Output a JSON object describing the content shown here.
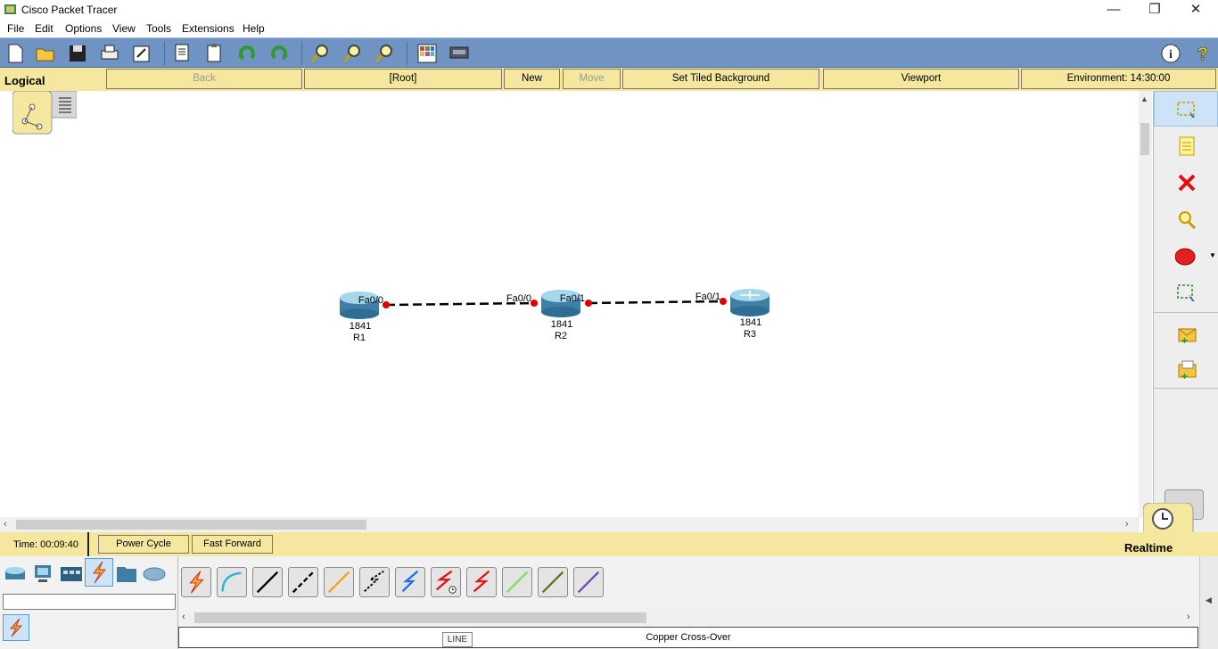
{
  "window": {
    "title": "Cisco Packet Tracer",
    "minimize": "—",
    "maximize": "❐",
    "close": "✕"
  },
  "menu": [
    "File",
    "Edit",
    "Options",
    "View",
    "Tools",
    "Extensions",
    "Help"
  ],
  "toolbar": [
    "new-icon",
    "open-icon",
    "save-icon",
    "print-icon",
    "activity-wizard-icon",
    "copy-icon",
    "paste-icon",
    "undo-icon",
    "redo-icon",
    "zoom-in-icon",
    "zoom-reset-icon",
    "zoom-out-icon",
    "palette-icon",
    "custom-device-icon",
    "info-icon",
    "help-icon"
  ],
  "nav": {
    "view": "Logical",
    "back": "Back",
    "root": "[Root]",
    "new_cluster": "New Cluster",
    "move_object": "Move Object",
    "tiled_bg": "Set Tiled Background",
    "viewport": "Viewport",
    "environment": "Environment: 14:30:00"
  },
  "topology": {
    "devices": [
      {
        "model": "1841",
        "name": "R1"
      },
      {
        "model": "1841",
        "name": "R2"
      },
      {
        "model": "1841",
        "name": "R3"
      }
    ],
    "links": [
      {
        "a_port": "Fa0/0",
        "b_port": "Fa0/0"
      },
      {
        "a_port": "Fa0/1",
        "b_port": "Fa0/1"
      }
    ]
  },
  "status": {
    "time": "Time: 00:09:40",
    "power_cycle": "Power Cycle Devices",
    "fast_forward": "Fast Forward Time",
    "mode": "Realtime"
  },
  "bottom": {
    "selected_cable": "Copper Cross-Over",
    "tooltip": "LINE",
    "search_value": "",
    "cable_types": [
      "Automatic",
      "Console",
      "Copper Straight-Through",
      "Copper Cross-Over",
      "Fiber",
      "Phone",
      "Coaxial",
      "Serial DCE",
      "Serial DTE",
      "Octal",
      "IoT Custom Cable",
      "USB"
    ]
  },
  "colors": {
    "toolbar": "#6f93c3",
    "bar": "#f5e79e",
    "link": "#000000",
    "port_dot": "#e00000"
  }
}
